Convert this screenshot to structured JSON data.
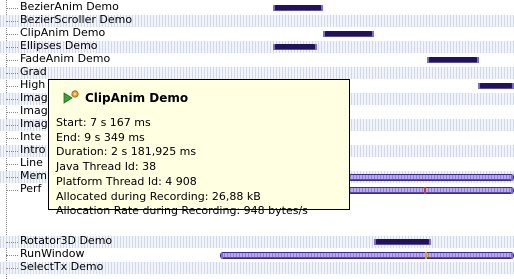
{
  "tree": {
    "rows": [
      {
        "label": "BezierAnim Demo",
        "shaded": false
      },
      {
        "label": "BezierScroller Demo",
        "shaded": true
      },
      {
        "label": "ClipAnim Demo",
        "shaded": false
      },
      {
        "label": "Ellipses Demo",
        "shaded": true
      },
      {
        "label": "FadeAnim Demo",
        "shaded": false
      },
      {
        "label": "Grad",
        "shaded": true
      },
      {
        "label": "High",
        "shaded": false
      },
      {
        "label": "Imag",
        "shaded": true
      },
      {
        "label": "Imag",
        "shaded": false
      },
      {
        "label": "Imag",
        "shaded": true
      },
      {
        "label": "Inte",
        "shaded": false
      },
      {
        "label": "Intro",
        "shaded": true
      },
      {
        "label": "Line",
        "shaded": false
      },
      {
        "label": "Mem",
        "shaded": true
      },
      {
        "label": "Perf",
        "shaded": false
      },
      {
        "label": "Rotator3D Demo",
        "shaded": true
      },
      {
        "label": "RunWindow",
        "shaded": false
      },
      {
        "label": "SelectTx Demo",
        "shaded": true
      }
    ]
  },
  "tooltip": {
    "title": "ClipAnim Demo",
    "icon": "thread-run-icon",
    "lines": [
      "Start: 7 s 167 ms",
      "End: 9 s 349 ms",
      "Duration: 2 s 181,925 ms",
      "Java Thread Id: 38",
      "Platform Thread Id: 4 908",
      "Allocated during Recording: 26,88 kB",
      "Allocation Rate during Recording: 948 bytes/s"
    ]
  },
  "colors": {
    "bar": "#22125a",
    "bar_highlight": "#7d6cd4",
    "long_bar": "#b9a9ee",
    "tooltip_bg": "#ffffe1",
    "row_shade": "#f1f4fb"
  }
}
